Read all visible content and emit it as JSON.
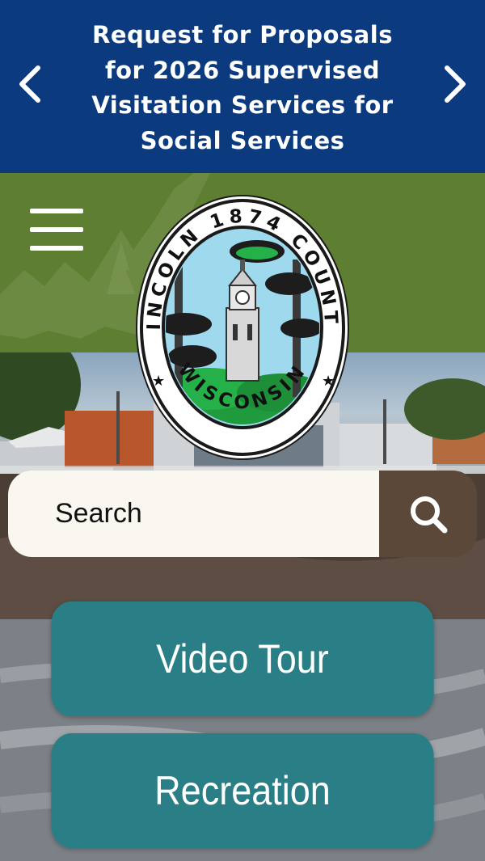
{
  "banner": {
    "text": "Request for Proposals for 2026 Supervised Visitation Services for Social Services",
    "prev_icon": "chevron-left-icon",
    "next_icon": "chevron-right-icon",
    "background": "#0b3a7e"
  },
  "header": {
    "menu_icon": "hamburger-menu-icon",
    "background": "#5e7f32"
  },
  "seal": {
    "year": "1874",
    "county_left": "LINCOLN",
    "county_right": "COUNTY",
    "state": "WISCONSIN"
  },
  "search": {
    "placeholder": "Search",
    "button_icon": "search-icon",
    "button_color": "#5b4838"
  },
  "quick_links": [
    {
      "label": "Video Tour"
    },
    {
      "label": "Recreation"
    }
  ],
  "colors": {
    "quick_link": "#2a7f86"
  }
}
